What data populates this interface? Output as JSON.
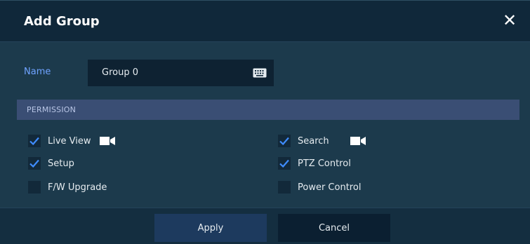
{
  "dialog": {
    "title": "Add Group",
    "close_icon": "close-icon"
  },
  "name": {
    "label": "Name",
    "value": "Group 0",
    "keyboard_icon": "keyboard-icon"
  },
  "permission": {
    "header": "PERMISSION",
    "items": [
      {
        "label": "Live View",
        "checked": true,
        "icon": "camera-icon"
      },
      {
        "label": "Search",
        "checked": true,
        "icon": "camera-icon"
      },
      {
        "label": "Setup",
        "checked": true
      },
      {
        "label": "PTZ Control",
        "checked": true
      },
      {
        "label": "F/W Upgrade",
        "checked": false
      },
      {
        "label": "Power Control",
        "checked": false
      }
    ]
  },
  "buttons": {
    "apply": "Apply",
    "cancel": "Cancel"
  },
  "colors": {
    "accent_check": "#3f8cff",
    "name_label": "#6fa3ff",
    "section_header_bg": "#3a4e74",
    "dialog_bg": "#1c3a4c"
  }
}
